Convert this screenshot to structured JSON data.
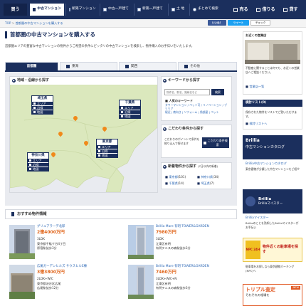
{
  "topnav": {
    "buy_label": "買う",
    "tabs": [
      {
        "label": "中古マンション"
      },
      {
        "label": "新築マンション"
      },
      {
        "label": "中古一戸建て"
      },
      {
        "label": "新築一戸建て"
      },
      {
        "label": "土 地"
      },
      {
        "label": "まとめて検索"
      }
    ],
    "right_buttons": [
      {
        "label": "売る",
        "color": "#e0392a"
      },
      {
        "label": "借りる",
        "color": "#e08a1e"
      },
      {
        "label": "貸す",
        "color": "#e0651a"
      }
    ]
  },
  "breadcrumb": {
    "home": "TOP",
    "current": "首都圏の中古マンションを購入する"
  },
  "social": {
    "like": "いいね！",
    "tweet": "ツイート",
    "check": "チェック",
    "share": "いいね！"
  },
  "page": {
    "title": "首都圏の中古マンションを購入する",
    "intro": "首都圏エリアの豊富な中古マンションの物件からご希望の条件にピッタリの中古マンションを検索し、物件購入のお手伝いをいたします。"
  },
  "region_tabs": [
    {
      "label": "首都圏"
    },
    {
      "label": "東海"
    },
    {
      "label": "関西"
    },
    {
      "label": "その他"
    }
  ],
  "map_section": {
    "heading": "地域・沿線から探す",
    "areas": [
      {
        "name": "埼玉県",
        "items": [
          "エリア",
          "沿線",
          "地図"
        ]
      },
      {
        "name": "千葉県",
        "items": [
          "エリア",
          "沿線",
          "地図"
        ]
      },
      {
        "name": "東京都",
        "items": [
          "エリア",
          "沿線",
          "地図"
        ]
      },
      {
        "name": "神奈川県",
        "items": [
          "エリア",
          "沿線",
          "地図"
        ]
      }
    ]
  },
  "keyword_section": {
    "heading": "キーワードから探す",
    "placeholder": "物件名、駅名、路線名など",
    "search_button": "検索",
    "popular_title": "人気のキーワード",
    "popular_keywords": "タワーマンション / ペット可 / リノベーション / ブリリア",
    "links": [
      "駅近",
      "南向き",
      "リフォーム",
      "角部屋",
      "ペット"
    ]
  },
  "condition_section": {
    "heading": "こだわり条件から探す",
    "desc": "こだわりのポイントで条件を絞り込んで探せます",
    "button": "こだわり条件検索"
  },
  "new_section": {
    "heading": "新着物件から探す",
    "heading_note": "(7日以内の新着)",
    "items": [
      {
        "label": "東京都",
        "count": "(101)"
      },
      {
        "label": "神奈川県",
        "count": "(34)"
      },
      {
        "label": "千葉県",
        "count": "(14)"
      },
      {
        "label": "埼玉県",
        "count": "(7)"
      }
    ]
  },
  "osusume": {
    "heading": "おすすめ物件情報",
    "properties": [
      {
        "name": "グリュアラーデ北邸",
        "price": "2億4000万円",
        "layout": "3LDK",
        "addr": "東京都千駄ケ谷4丁目",
        "station": "原宿駅徒歩3分"
      },
      {
        "name": "Brillia Mare 有明 TOWER&GARDEN",
        "price": "7980万円",
        "layout": "3LDK",
        "addr": "江東区有明",
        "station": "有明テニスの森駅徒歩3分"
      },
      {
        "name": "広尾ガーデンヒルズ サウスヒルE棟",
        "price": "3億3800万円",
        "layout": "2LDK+WIC",
        "addr": "東京都渋谷区広尾",
        "station": "広尾駅徒歩12分"
      },
      {
        "name": "Brillia Mare 有明 TOWER&GARDEN",
        "price": "7460万円",
        "layout": "3LDK+WIC+N",
        "addr": "江東区有明",
        "station": "有明テニスの森駅徒歩3分"
      }
    ]
  },
  "sidebar": {
    "store_title": "お近くの営業店",
    "store_desc": "不動産に関することは何でも、お近くの営業店へご相談ください。",
    "store_link": "営業店一覧",
    "history_title": "検討リスト(0)",
    "history_desc": "保存された物件をリストでご覧いただけます。",
    "history_link": "検討リストへ",
    "banner1_brand": "Brillia",
    "banner1_title": "中古マンションカタログ",
    "banner1_sub": "Brillia中古マンションカタログ",
    "banner1_desc": "東京建物が分譲した中古マンションをご紹介",
    "banner2_brand": "Brillia",
    "banner2_title": "Brilliaマイスター",
    "banner2_sub": "Brilliaマイスター",
    "banner2_desc": "Brilliaのことを熟知したBrilliaマイスターがお手伝い",
    "banner3_title": "物件近くの駐車場を探す",
    "banner3_badge": "NPC 24H",
    "banner3_desc": "駐車場をお探しなら東京建物パーキング(NPC)へ",
    "banner4_title": "トリプル査定",
    "banner4_sub": "それぞれの相場を",
    "banner4_badge": "NEW"
  },
  "colors": {
    "navy": "#1b2f5d",
    "orange_price": "#e0651a",
    "map_land": "#dbe8bd",
    "map_sea": "#e9ebf0"
  }
}
